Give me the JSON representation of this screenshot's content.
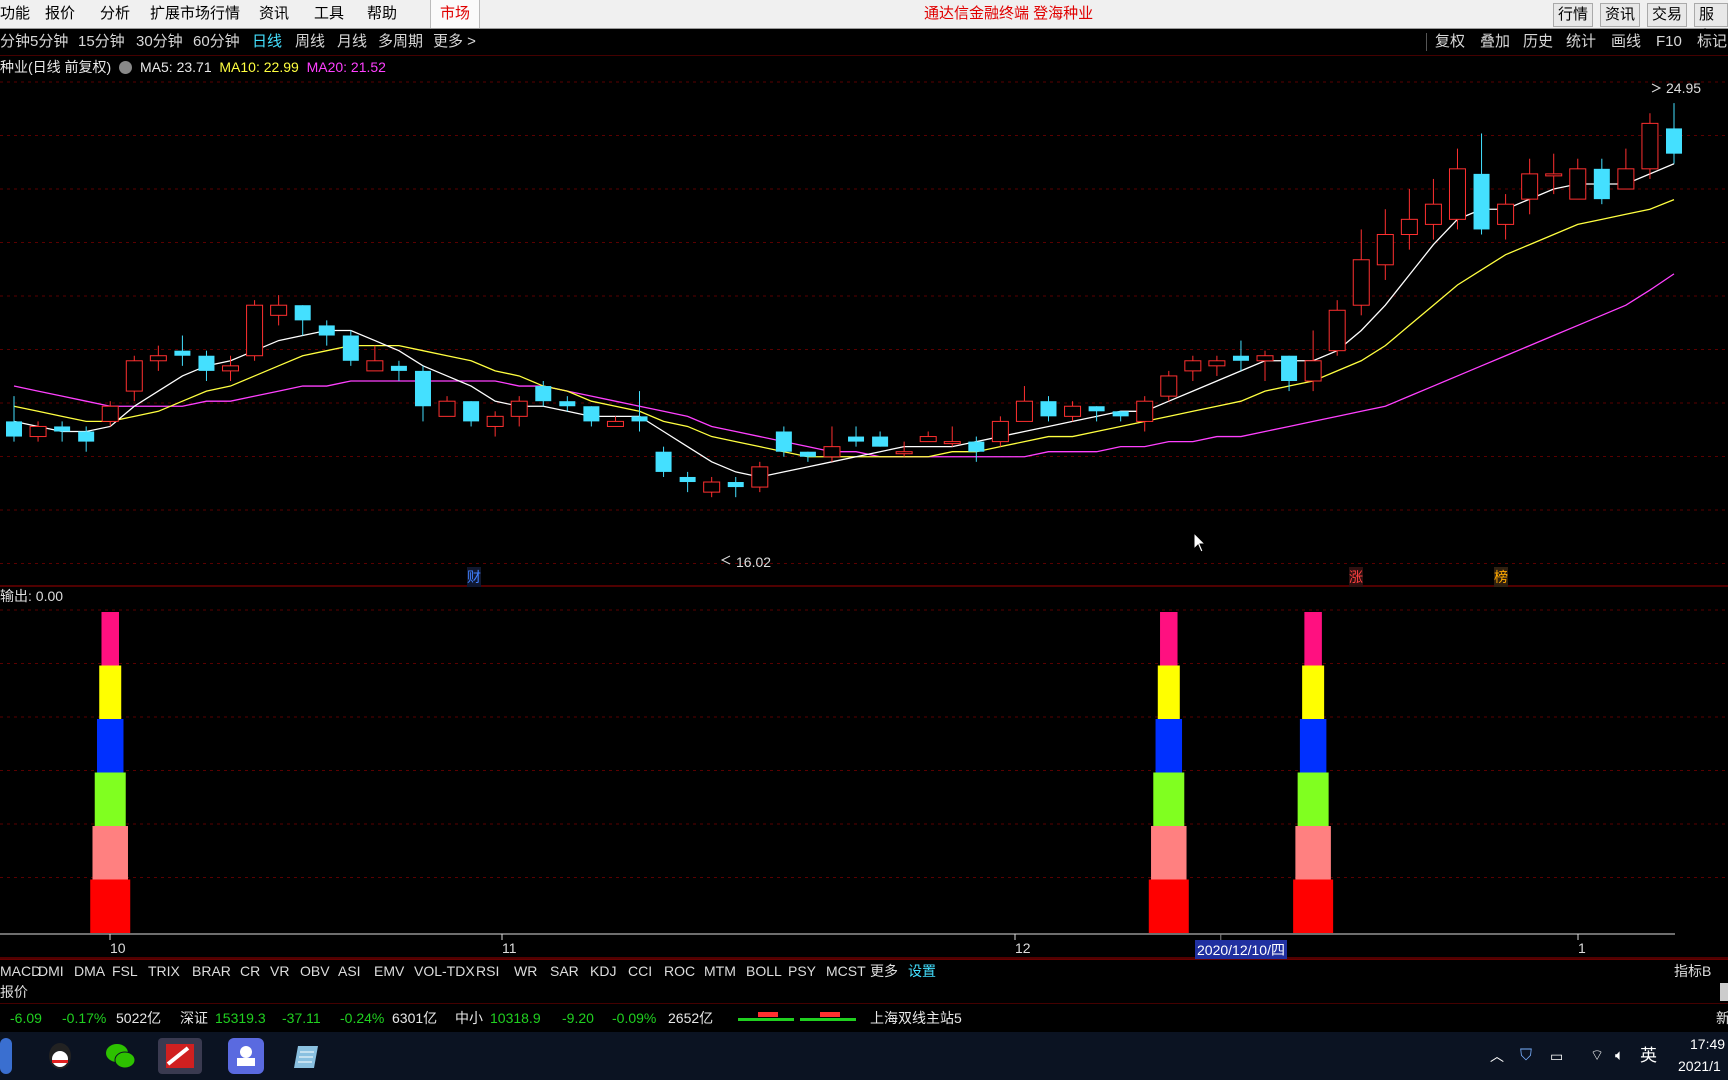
{
  "menubar": {
    "items": [
      "功能",
      "报价",
      "分析",
      "扩展市场行情",
      "资讯",
      "工具",
      "帮助"
    ],
    "market": "市场",
    "center_title": "通达信金融终端  登海种业",
    "right_buttons": [
      "行情",
      "资讯",
      "交易",
      "服务"
    ]
  },
  "periods": {
    "items": [
      "分钟",
      "5分钟",
      "15分钟",
      "30分钟",
      "60分钟",
      "日线",
      "周线",
      "月线",
      "多周期",
      "更多 >"
    ],
    "active": "日线",
    "tools": [
      "复权",
      "叠加",
      "历史",
      "统计",
      "画线",
      "F10",
      "标记"
    ]
  },
  "info": {
    "stock": "种业(日线 前复权)",
    "ma5_label": "MA5: 23.71",
    "ma10_label": "MA10: 22.99",
    "ma20_label": "MA20: 21.52",
    "colors": {
      "ma5": "#ffffff",
      "ma10": "#ffff40",
      "ma20": "#ff40ff",
      "up": "#ff3030",
      "down": "#44e0ff"
    }
  },
  "main_chart": {
    "high_label": "24.95",
    "low_label": "16.02",
    "markers": [
      "财",
      "涨",
      "榜"
    ]
  },
  "sub_chart": {
    "title": "输出: 0.00",
    "colors": [
      "#ff0000",
      "#ff8080",
      "#80ff20",
      "#0030ff",
      "#ffff00",
      "#ff1080"
    ]
  },
  "x_axis": {
    "labels": [
      "10",
      "11",
      "12",
      "1"
    ],
    "cursor_date": "2020/12/10/四"
  },
  "indicators": {
    "items": [
      "MACD",
      "DMI",
      "DMA",
      "FSL",
      "TRIX",
      "BRAR",
      "CR",
      "VR",
      "OBV",
      "ASI",
      "EMV",
      "VOL-TDX",
      "RSI",
      "WR",
      "SAR",
      "KDJ",
      "CCI",
      "ROC",
      "MTM",
      "BOLL",
      "PSY",
      "MCST",
      "更多",
      "设置"
    ],
    "active": "设置",
    "right": "指标B"
  },
  "quote_line": {
    "label": "报价"
  },
  "status": {
    "sh_chg": "-6.09",
    "sh_pct": "-0.17%",
    "sh_amt": "5022亿",
    "sz_name": "深证",
    "sz_val": "15319.3",
    "sz_chg": "-37.11",
    "sz_pct": "-0.24%",
    "sz_amt": "6301亿",
    "zx_name": "中小",
    "zx_val": "10318.9",
    "zx_chg": "-9.20",
    "zx_pct": "-0.09%",
    "zx_amt": "2652亿",
    "server": "上海双线主站5",
    "right_char": "新"
  },
  "taskbar": {
    "ime": "英",
    "time": "17:49",
    "date": "2021/1"
  },
  "chart_data": {
    "type": "candlestick",
    "x_labels": [
      "10",
      "11",
      "12",
      "1"
    ],
    "candles": [
      [
        18.6,
        18.3,
        19.1,
        18.2
      ],
      [
        18.3,
        18.5,
        18.6,
        18.2
      ],
      [
        18.5,
        18.4,
        18.6,
        18.2
      ],
      [
        18.4,
        18.2,
        18.5,
        18.0
      ],
      [
        18.6,
        18.9,
        19.0,
        18.5
      ],
      [
        19.2,
        19.8,
        19.9,
        19.0
      ],
      [
        19.8,
        19.9,
        20.1,
        19.6
      ],
      [
        20.0,
        19.9,
        20.3,
        19.7
      ],
      [
        19.9,
        19.6,
        20.0,
        19.4
      ],
      [
        19.6,
        19.7,
        19.9,
        19.4
      ],
      [
        19.9,
        20.9,
        21.0,
        19.8
      ],
      [
        20.7,
        20.9,
        21.1,
        20.5
      ],
      [
        20.9,
        20.6,
        20.9,
        20.3
      ],
      [
        20.5,
        20.3,
        20.6,
        20.1
      ],
      [
        20.3,
        19.8,
        20.4,
        19.7
      ],
      [
        19.6,
        19.8,
        20.1,
        19.6
      ],
      [
        19.7,
        19.6,
        19.8,
        19.4
      ],
      [
        19.6,
        18.9,
        19.7,
        18.6
      ],
      [
        18.7,
        19.0,
        19.1,
        18.7
      ],
      [
        19.0,
        18.6,
        19.0,
        18.5
      ],
      [
        18.5,
        18.7,
        18.8,
        18.3
      ],
      [
        18.7,
        19.0,
        19.1,
        18.5
      ],
      [
        19.3,
        19.0,
        19.4,
        18.9
      ],
      [
        19.0,
        18.9,
        19.1,
        18.8
      ],
      [
        18.9,
        18.6,
        18.9,
        18.5
      ],
      [
        18.5,
        18.6,
        18.7,
        18.5
      ],
      [
        18.7,
        18.6,
        19.2,
        18.4
      ],
      [
        18.0,
        17.6,
        18.1,
        17.5
      ],
      [
        17.5,
        17.4,
        17.6,
        17.2
      ],
      [
        17.2,
        17.4,
        17.5,
        17.1
      ],
      [
        17.4,
        17.3,
        17.5,
        17.1
      ],
      [
        17.3,
        17.7,
        17.8,
        17.2
      ],
      [
        18.4,
        18.0,
        18.5,
        17.9
      ],
      [
        18.0,
        17.9,
        18.0,
        17.8
      ],
      [
        17.9,
        18.1,
        18.5,
        17.8
      ],
      [
        18.3,
        18.2,
        18.5,
        18.1
      ],
      [
        18.3,
        18.1,
        18.4,
        18.1
      ],
      [
        18.0,
        18.0,
        18.2,
        17.9
      ],
      [
        18.2,
        18.3,
        18.4,
        18.2
      ],
      [
        18.2,
        18.2,
        18.5,
        18.1
      ],
      [
        18.2,
        18.0,
        18.3,
        17.8
      ],
      [
        18.2,
        18.6,
        18.7,
        18.1
      ],
      [
        18.6,
        19.0,
        19.3,
        18.6
      ],
      [
        19.0,
        18.7,
        19.1,
        18.6
      ],
      [
        18.7,
        18.9,
        19.0,
        18.6
      ],
      [
        18.9,
        18.8,
        18.9,
        18.6
      ],
      [
        18.8,
        18.7,
        18.8,
        18.6
      ],
      [
        18.6,
        19.0,
        19.1,
        18.4
      ],
      [
        19.1,
        19.5,
        19.6,
        19.0
      ],
      [
        19.6,
        19.8,
        19.9,
        19.4
      ],
      [
        19.7,
        19.8,
        19.9,
        19.5
      ],
      [
        19.9,
        19.8,
        20.2,
        19.6
      ],
      [
        19.8,
        19.9,
        20.0,
        19.4
      ],
      [
        19.9,
        19.4,
        19.9,
        19.2
      ],
      [
        19.4,
        19.8,
        20.4,
        19.2
      ],
      [
        20.0,
        20.8,
        21.0,
        19.9
      ],
      [
        20.9,
        21.8,
        22.4,
        20.7
      ],
      [
        21.7,
        22.3,
        22.8,
        21.4
      ],
      [
        22.3,
        22.6,
        23.2,
        22.0
      ],
      [
        22.5,
        22.9,
        23.4,
        22.2
      ],
      [
        22.6,
        23.6,
        24.0,
        22.4
      ],
      [
        23.5,
        22.4,
        24.3,
        22.3
      ],
      [
        22.5,
        22.9,
        23.1,
        22.2
      ],
      [
        23.0,
        23.5,
        23.8,
        22.7
      ],
      [
        23.5,
        23.5,
        23.9,
        23.1
      ],
      [
        23.0,
        23.6,
        23.8,
        23.0
      ],
      [
        23.6,
        23.0,
        23.8,
        22.9
      ],
      [
        23.2,
        23.6,
        24.0,
        23.2
      ],
      [
        23.6,
        24.5,
        24.7,
        23.4
      ],
      [
        24.4,
        23.9,
        24.9,
        23.7
      ]
    ],
    "ma5": [
      18.6,
      18.5,
      18.4,
      18.4,
      18.5,
      18.9,
      19.2,
      19.5,
      19.7,
      19.8,
      20.0,
      20.2,
      20.3,
      20.4,
      20.4,
      20.2,
      20.0,
      19.7,
      19.5,
      19.3,
      19.0,
      18.9,
      18.9,
      18.8,
      18.7,
      18.7,
      18.7,
      18.4,
      18.1,
      17.8,
      17.6,
      17.5,
      17.6,
      17.7,
      17.8,
      17.9,
      18.0,
      18.1,
      18.1,
      18.1,
      18.2,
      18.3,
      18.4,
      18.5,
      18.6,
      18.7,
      18.8,
      18.8,
      19.0,
      19.2,
      19.4,
      19.6,
      19.8,
      19.8,
      19.8,
      20.0,
      20.4,
      20.9,
      21.5,
      22.1,
      22.6,
      22.8,
      22.8,
      23.0,
      23.2,
      23.3,
      23.3,
      23.3,
      23.5,
      23.7
    ],
    "ma10": [
      18.9,
      18.8,
      18.7,
      18.6,
      18.6,
      18.7,
      18.8,
      19.0,
      19.2,
      19.3,
      19.5,
      19.7,
      19.9,
      20.0,
      20.1,
      20.1,
      20.1,
      20.0,
      19.9,
      19.8,
      19.6,
      19.5,
      19.3,
      19.2,
      19.0,
      18.9,
      18.8,
      18.6,
      18.5,
      18.3,
      18.2,
      18.1,
      18.0,
      17.9,
      17.9,
      17.9,
      17.9,
      17.9,
      17.9,
      18.0,
      18.0,
      18.1,
      18.2,
      18.3,
      18.3,
      18.4,
      18.5,
      18.6,
      18.7,
      18.8,
      18.9,
      19.0,
      19.2,
      19.3,
      19.4,
      19.6,
      19.8,
      20.1,
      20.5,
      20.9,
      21.3,
      21.6,
      21.9,
      22.1,
      22.3,
      22.5,
      22.6,
      22.7,
      22.8,
      22.99
    ],
    "ma20": [
      19.3,
      19.2,
      19.1,
      19.0,
      18.9,
      18.9,
      18.9,
      18.9,
      19.0,
      19.0,
      19.1,
      19.2,
      19.3,
      19.3,
      19.4,
      19.4,
      19.4,
      19.4,
      19.4,
      19.4,
      19.4,
      19.3,
      19.3,
      19.2,
      19.1,
      19.0,
      18.9,
      18.8,
      18.7,
      18.5,
      18.4,
      18.3,
      18.2,
      18.1,
      18.0,
      18.0,
      17.9,
      17.9,
      17.9,
      17.9,
      17.9,
      17.9,
      17.9,
      18.0,
      18.0,
      18.0,
      18.1,
      18.1,
      18.2,
      18.2,
      18.3,
      18.3,
      18.4,
      18.5,
      18.6,
      18.7,
      18.8,
      18.9,
      19.1,
      19.3,
      19.5,
      19.7,
      19.9,
      20.1,
      20.3,
      20.5,
      20.7,
      20.9,
      21.2,
      21.52
    ],
    "signal_bars_at_index": [
      4,
      48,
      54
    ],
    "signal_levels": 6
  }
}
